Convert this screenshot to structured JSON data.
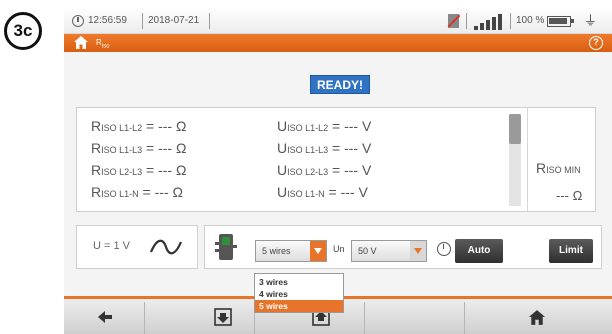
{
  "step_badge": "3c",
  "status": {
    "time": "12:56:59",
    "date": "2018-07-21",
    "battery_pct": "100 %"
  },
  "titlebar": {
    "title": "R",
    "title_sub": "iso"
  },
  "ready": "READY!",
  "results": {
    "rows": [
      {
        "r_main": "R",
        "r_sub": "ISO L1-L2",
        "r_val": " = --- Ω",
        "u_main": "U",
        "u_sub": "ISO L1-L2",
        "u_val": " = --- V"
      },
      {
        "r_main": "R",
        "r_sub": "ISO L1-L3",
        "r_val": " = --- Ω",
        "u_main": "U",
        "u_sub": "ISO L1-L3",
        "u_val": " = --- V"
      },
      {
        "r_main": "R",
        "r_sub": "ISO L2-L3",
        "r_val": " = --- Ω",
        "u_main": "U",
        "u_sub": "ISO L2-L3",
        "u_val": " = --- V"
      },
      {
        "r_main": "R",
        "r_sub": "ISO L1-N",
        "r_val": " = --- Ω",
        "u_main": "U",
        "u_sub": "ISO L1-N",
        "u_val": " = --- V"
      }
    ],
    "min_label_main": "R",
    "min_label_sub": "ISO MIN",
    "min_value": "--- Ω"
  },
  "controls": {
    "voltage": "U = 1 V",
    "wires_selected": "5 wires",
    "un_label": "Un",
    "un_value": "50 V",
    "auto_label": "Auto",
    "limit_label": "Limit"
  },
  "dropdown": {
    "options": [
      "3 wires",
      "4 wires",
      "5 wires"
    ],
    "selected_index": 2
  },
  "icons": {
    "status": [
      "clock-icon",
      "no-memory-card-icon",
      "signal-strength-icon",
      "battery-icon",
      "power-plug-icon"
    ],
    "bottom": [
      "back-arrow-icon",
      "save-icon",
      "export-icon",
      "home-icon"
    ]
  },
  "colors": {
    "accent": "#e8742a",
    "ready_bg": "#2f73c2",
    "button_dark": "#3a3a3a"
  }
}
